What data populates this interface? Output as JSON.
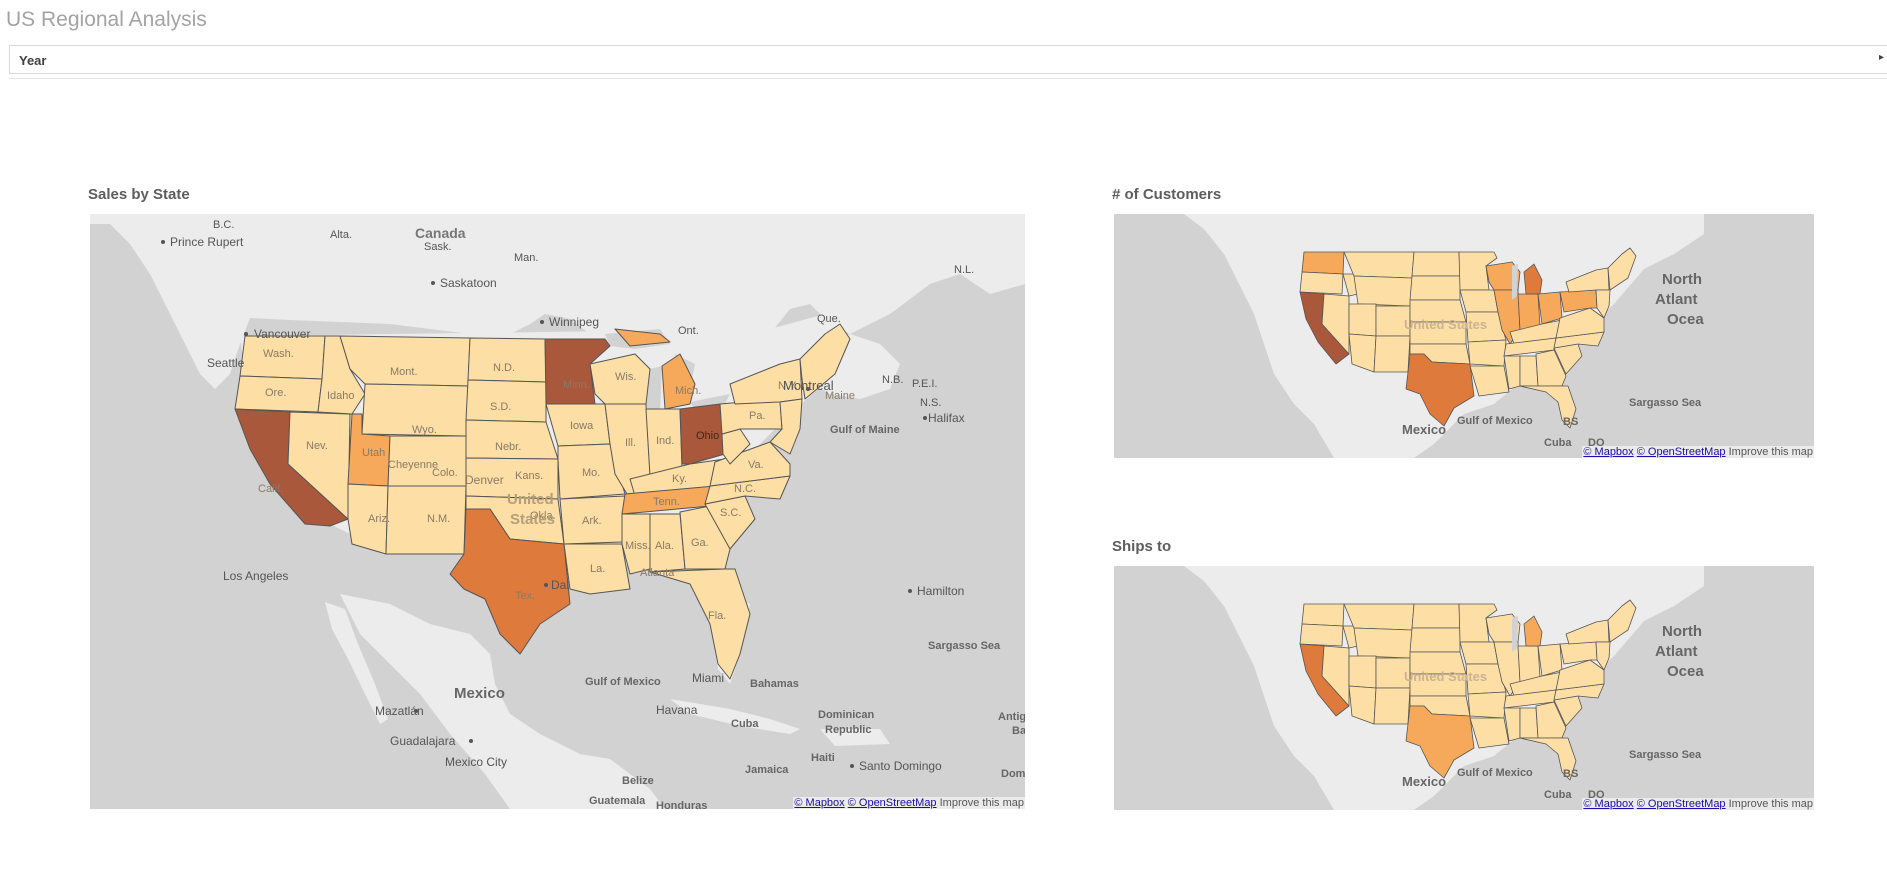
{
  "app": {
    "title": "US Regional Analysis"
  },
  "filter": {
    "label": "Year",
    "arrow": "▸"
  },
  "colors": {
    "water": "#d2d2d2",
    "land": "#ececec",
    "low": "#fddea5",
    "mid": "#f6a95a",
    "high": "#de7a3c",
    "top": "#a9583b",
    "border": "#555555"
  },
  "attribution": {
    "mapbox": "© Mapbox",
    "osm": "© OpenStreetMap",
    "improve": "Improve this map"
  },
  "maps": {
    "sales": {
      "title": "Sales by State",
      "labels": {
        "bc": "B.C.",
        "alta": "Alta.",
        "canada": "Canada",
        "sask": "Sask.",
        "man": "Man.",
        "nl": "N.L.",
        "prince_rupert": "Prince Rupert",
        "saskatoon": "Saskatoon",
        "winnipeg": "Winnipeg",
        "ont": "Ont.",
        "que": "Que.",
        "vancouver": "Vancouver",
        "seattle": "Seattle",
        "montreal": "Montreal",
        "nb": "N.B.",
        "pei": "P.E.I.",
        "ns": "N.S.",
        "halifax": "Halifax",
        "gulf_maine": "Gulf of Maine",
        "hamilton": "Hamilton",
        "sargasso": "Sargasso Sea",
        "los_angeles": "Los Angeles",
        "gulf_mexico": "Gulf of Mexico",
        "bahamas": "Bahamas",
        "mexico": "Mexico",
        "mazatlan": "Mazatlán",
        "havana": "Havana",
        "cuba": "Cuba",
        "dominican": "Dominican",
        "republic": "Republic",
        "antigua": "Antig",
        "ba": "Ba",
        "guadalajara": "Guadalajara",
        "mexico_city": "Mexico City",
        "jamaica": "Jamaica",
        "haiti": "Haiti",
        "santo_domingo": "Santo Domingo",
        "dom": "Dom",
        "belize": "Belize",
        "guatemala": "Guatemala",
        "honduras": "Honduras",
        "miami": "Miami",
        "dallas": "Dal",
        "denver": "Denver",
        "united": "United",
        "states": "States",
        "cheyenne": "Cheyenne",
        "wash": "Wash.",
        "ore": "Ore.",
        "calif": "Calif.",
        "nev": "Nev.",
        "idaho": "Idaho",
        "mont": "Mont.",
        "wyo": "Wyo.",
        "utah": "Utah",
        "colo": "Colo.",
        "ariz": "Ariz.",
        "nm": "N.M.",
        "nd": "N.D.",
        "sd": "S.D.",
        "nebr": "Nebr.",
        "kans": "Kans.",
        "okla": "Okla.",
        "tex": "Tex.",
        "minn": "Minn.",
        "iowa": "Iowa",
        "mo": "Mo.",
        "ark": "Ark.",
        "la": "La.",
        "wis": "Wis.",
        "ill": "Ill.",
        "ind": "Ind.",
        "mich": "Mich.",
        "ohio": "Ohio",
        "ky": "Ky.",
        "tenn": "Tenn.",
        "miss": "Miss.",
        "ala": "Ala.",
        "ga": "Ga.",
        "fla": "Fla.",
        "sc": "S.C.",
        "nc": "N.C.",
        "va": "Va.",
        "pa": "Pa.",
        "ny": "N.Y.",
        "maine": "Maine",
        "atlanta": "Atlanta"
      }
    },
    "customers": {
      "title": "# of Customers",
      "labels": {
        "north": "North",
        "atlantic": "Atlant",
        "ocean": "Ocea",
        "sargasso": "Sargasso Sea",
        "mexico": "Mexico",
        "gulf_mexico": "Gulf of Mexico",
        "bs": "BS",
        "cuba": "Cuba",
        "do": "DO",
        "united_states": "United States"
      }
    },
    "ships": {
      "title": "Ships to",
      "labels": {
        "north": "North",
        "atlantic": "Atlant",
        "ocean": "Ocea",
        "sargasso": "Sargasso Sea",
        "mexico": "Mexico",
        "gulf_mexico": "Gulf of Mexico",
        "bs": "BS",
        "cuba": "Cuba",
        "do": "DO",
        "united_states": "United States"
      }
    }
  },
  "state_levels": {
    "sales": {
      "high": [
        "Calif.",
        "Minn.",
        "Ohio"
      ],
      "medium": [
        "Tex."
      ],
      "elevated": [
        "Utah",
        "Mich.",
        "Tenn."
      ]
    },
    "customers": {
      "high": [
        "Calif."
      ],
      "medium": [
        "Tex.",
        "Mich."
      ],
      "elevated": [
        "Wash.",
        "Wis.",
        "Ill.",
        "Ind.",
        "Ohio",
        "Pa.",
        "N.Y."
      ]
    },
    "ships": {
      "high": [
        "Calif."
      ],
      "medium": [
        "Tex."
      ],
      "elevated": [
        "Mich."
      ]
    }
  }
}
